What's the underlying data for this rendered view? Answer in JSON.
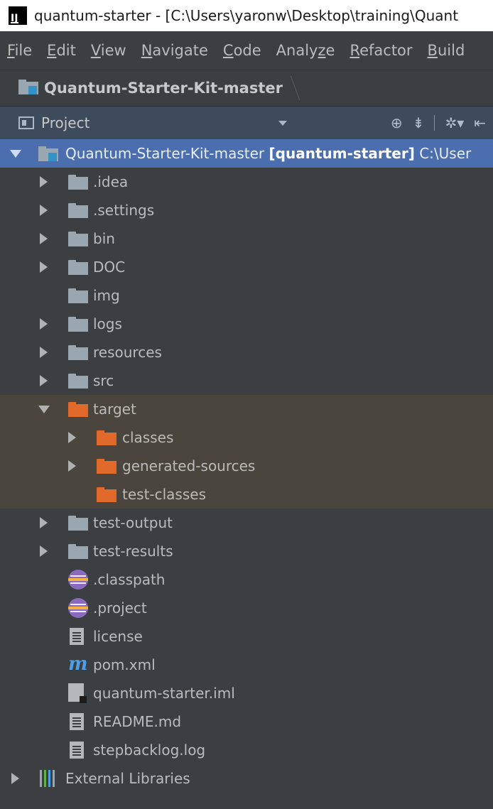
{
  "window": {
    "title": "quantum-starter - [C:\\Users\\yaronw\\Desktop\\training\\Quant"
  },
  "menu": [
    {
      "mn": "F",
      "rest": "ile"
    },
    {
      "mn": "E",
      "rest": "dit"
    },
    {
      "mn": "V",
      "rest": "iew"
    },
    {
      "mn": "N",
      "rest": "avigate"
    },
    {
      "mn": "C",
      "rest": "ode"
    },
    {
      "pre": "Analy",
      "mn": "z",
      "rest": "e"
    },
    {
      "mn": "R",
      "rest": "efactor"
    },
    {
      "mn": "B",
      "rest": "uild"
    }
  ],
  "navbar": {
    "crumb": "Quantum-Starter-Kit-master",
    "crumb_icon": "module-folder-icon"
  },
  "toolbar": {
    "label": "Project",
    "icons": [
      "locate-icon",
      "collapse-all-icon",
      "settings-icon",
      "hide-panel-icon"
    ]
  },
  "tree": {
    "root": {
      "name": "Quantum-Starter-Kit-master",
      "module": "[quantum-starter]",
      "path": "C:\\User"
    },
    "items": [
      {
        "name": ".idea",
        "icon": "folder-icon"
      },
      {
        "name": ".settings",
        "icon": "folder-icon"
      },
      {
        "name": "bin",
        "icon": "folder-icon"
      },
      {
        "name": "DOC",
        "icon": "folder-icon"
      },
      {
        "name": "img",
        "icon": "folder-icon"
      },
      {
        "name": "logs",
        "icon": "folder-icon"
      },
      {
        "name": "resources",
        "icon": "folder-icon"
      },
      {
        "name": "src",
        "icon": "folder-icon"
      },
      {
        "name": "target",
        "icon": "excluded-folder-icon"
      },
      {
        "name": "classes",
        "icon": "excluded-folder-icon"
      },
      {
        "name": "generated-sources",
        "icon": "excluded-folder-icon"
      },
      {
        "name": "test-classes",
        "icon": "excluded-folder-icon"
      },
      {
        "name": "test-output",
        "icon": "folder-icon"
      },
      {
        "name": "test-results",
        "icon": "folder-icon"
      },
      {
        "name": ".classpath",
        "icon": "eclipse-file-icon"
      },
      {
        "name": ".project",
        "icon": "eclipse-file-icon"
      },
      {
        "name": "license",
        "icon": "text-file-icon"
      },
      {
        "name": "pom.xml",
        "icon": "maven-icon"
      },
      {
        "name": "quantum-starter.iml",
        "icon": "module-file-icon"
      },
      {
        "name": "README.md",
        "icon": "text-file-icon"
      },
      {
        "name": "stepbacklog.log",
        "icon": "text-file-icon"
      }
    ],
    "external": {
      "name": "External Libraries",
      "icon": "library-icon"
    }
  },
  "colors": {
    "selection": "#4b6eaf",
    "excluded_highlight": "#4a453d",
    "excluded_folder": "#e1692a",
    "panel_bg": "#3c3f41"
  }
}
